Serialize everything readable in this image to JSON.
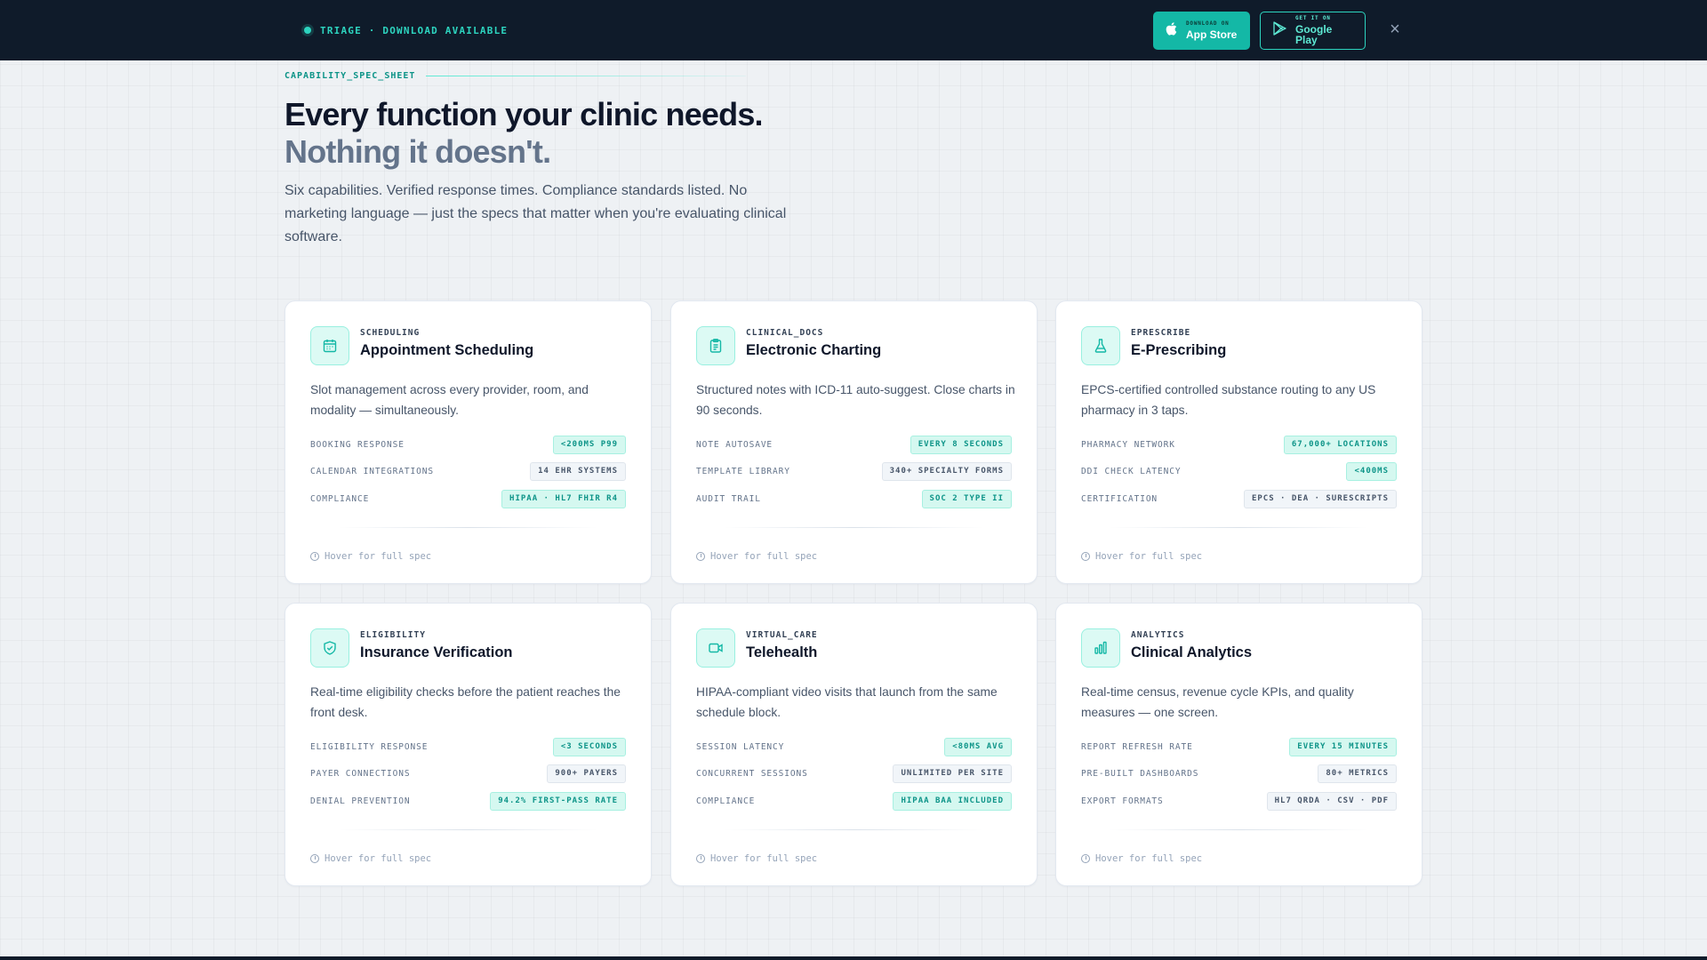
{
  "banner": {
    "label": "TRIAGE · DOWNLOAD AVAILABLE",
    "app_store": {
      "small": "DOWNLOAD ON",
      "big": "App Store",
      "icon": "apple-icon"
    },
    "google_play": {
      "small": "GET IT ON",
      "big": "Google Play",
      "icon": "play-icon"
    },
    "close": "×"
  },
  "hero": {
    "eyebrow": "CAPABILITY_SPEC_SHEET",
    "title_line1": "Every function your clinic needs.",
    "title_line2": "Nothing it doesn't.",
    "lead": "Six capabilities. Verified response times. Compliance standards listed. No marketing language — just the specs that matter when you're evaluating clinical software."
  },
  "cards": [
    {
      "tag": "SCHEDULING",
      "title": "Appointment Scheduling",
      "icon": "calendar-icon",
      "desc": "Slot management across every provider, room, and modality — simultaneously.",
      "specs": [
        {
          "key": "BOOKING RESPONSE",
          "value": "<200MS P99",
          "style": "teal"
        },
        {
          "key": "CALENDAR INTEGRATIONS",
          "value": "14 EHR SYSTEMS",
          "style": "gray"
        },
        {
          "key": "COMPLIANCE",
          "value": "HIPAA · HL7 FHIR R4",
          "style": "teal"
        }
      ],
      "hover": "Hover for full spec"
    },
    {
      "tag": "CLINICAL_DOCS",
      "title": "Electronic Charting",
      "icon": "clipboard-icon",
      "desc": "Structured notes with ICD-11 auto-suggest. Close charts in 90 seconds.",
      "specs": [
        {
          "key": "NOTE AUTOSAVE",
          "value": "EVERY 8 SECONDS",
          "style": "teal"
        },
        {
          "key": "TEMPLATE LIBRARY",
          "value": "340+ SPECIALTY FORMS",
          "style": "gray"
        },
        {
          "key": "AUDIT TRAIL",
          "value": "SOC 2 TYPE II",
          "style": "teal"
        }
      ],
      "hover": "Hover for full spec"
    },
    {
      "tag": "EPRESCRIBE",
      "title": "E-Prescribing",
      "icon": "flask-icon",
      "desc": "EPCS-certified controlled substance routing to any US pharmacy in 3 taps.",
      "specs": [
        {
          "key": "PHARMACY NETWORK",
          "value": "67,000+ LOCATIONS",
          "style": "teal"
        },
        {
          "key": "DDI CHECK LATENCY",
          "value": "<400MS",
          "style": "teal"
        },
        {
          "key": "CERTIFICATION",
          "value": "EPCS · DEA · SURESCRIPTS",
          "style": "gray"
        }
      ],
      "hover": "Hover for full spec"
    },
    {
      "tag": "ELIGIBILITY",
      "title": "Insurance Verification",
      "icon": "shield-check-icon",
      "desc": "Real-time eligibility checks before the patient reaches the front desk.",
      "specs": [
        {
          "key": "ELIGIBILITY RESPONSE",
          "value": "<3 SECONDS",
          "style": "teal"
        },
        {
          "key": "PAYER CONNECTIONS",
          "value": "900+ PAYERS",
          "style": "gray"
        },
        {
          "key": "DENIAL PREVENTION",
          "value": "94.2% FIRST-PASS RATE",
          "style": "teal"
        }
      ],
      "hover": "Hover for full spec"
    },
    {
      "tag": "VIRTUAL_CARE",
      "title": "Telehealth",
      "icon": "video-icon",
      "desc": "HIPAA-compliant video visits that launch from the same schedule block.",
      "specs": [
        {
          "key": "SESSION LATENCY",
          "value": "<80MS AVG",
          "style": "teal"
        },
        {
          "key": "CONCURRENT SESSIONS",
          "value": "UNLIMITED PER SITE",
          "style": "gray"
        },
        {
          "key": "COMPLIANCE",
          "value": "HIPAA BAA INCLUDED",
          "style": "teal"
        }
      ],
      "hover": "Hover for full spec"
    },
    {
      "tag": "ANALYTICS",
      "title": "Clinical Analytics",
      "icon": "bar-chart-icon",
      "desc": "Real-time census, revenue cycle KPIs, and quality measures — one screen.",
      "specs": [
        {
          "key": "REPORT REFRESH RATE",
          "value": "EVERY 15 MINUTES",
          "style": "teal"
        },
        {
          "key": "PRE-BUILT DASHBOARDS",
          "value": "80+ METRICS",
          "style": "gray"
        },
        {
          "key": "EXPORT FORMATS",
          "value": "HL7 QRDA · CSV · PDF",
          "style": "gray"
        }
      ],
      "hover": "Hover for full spec"
    }
  ]
}
